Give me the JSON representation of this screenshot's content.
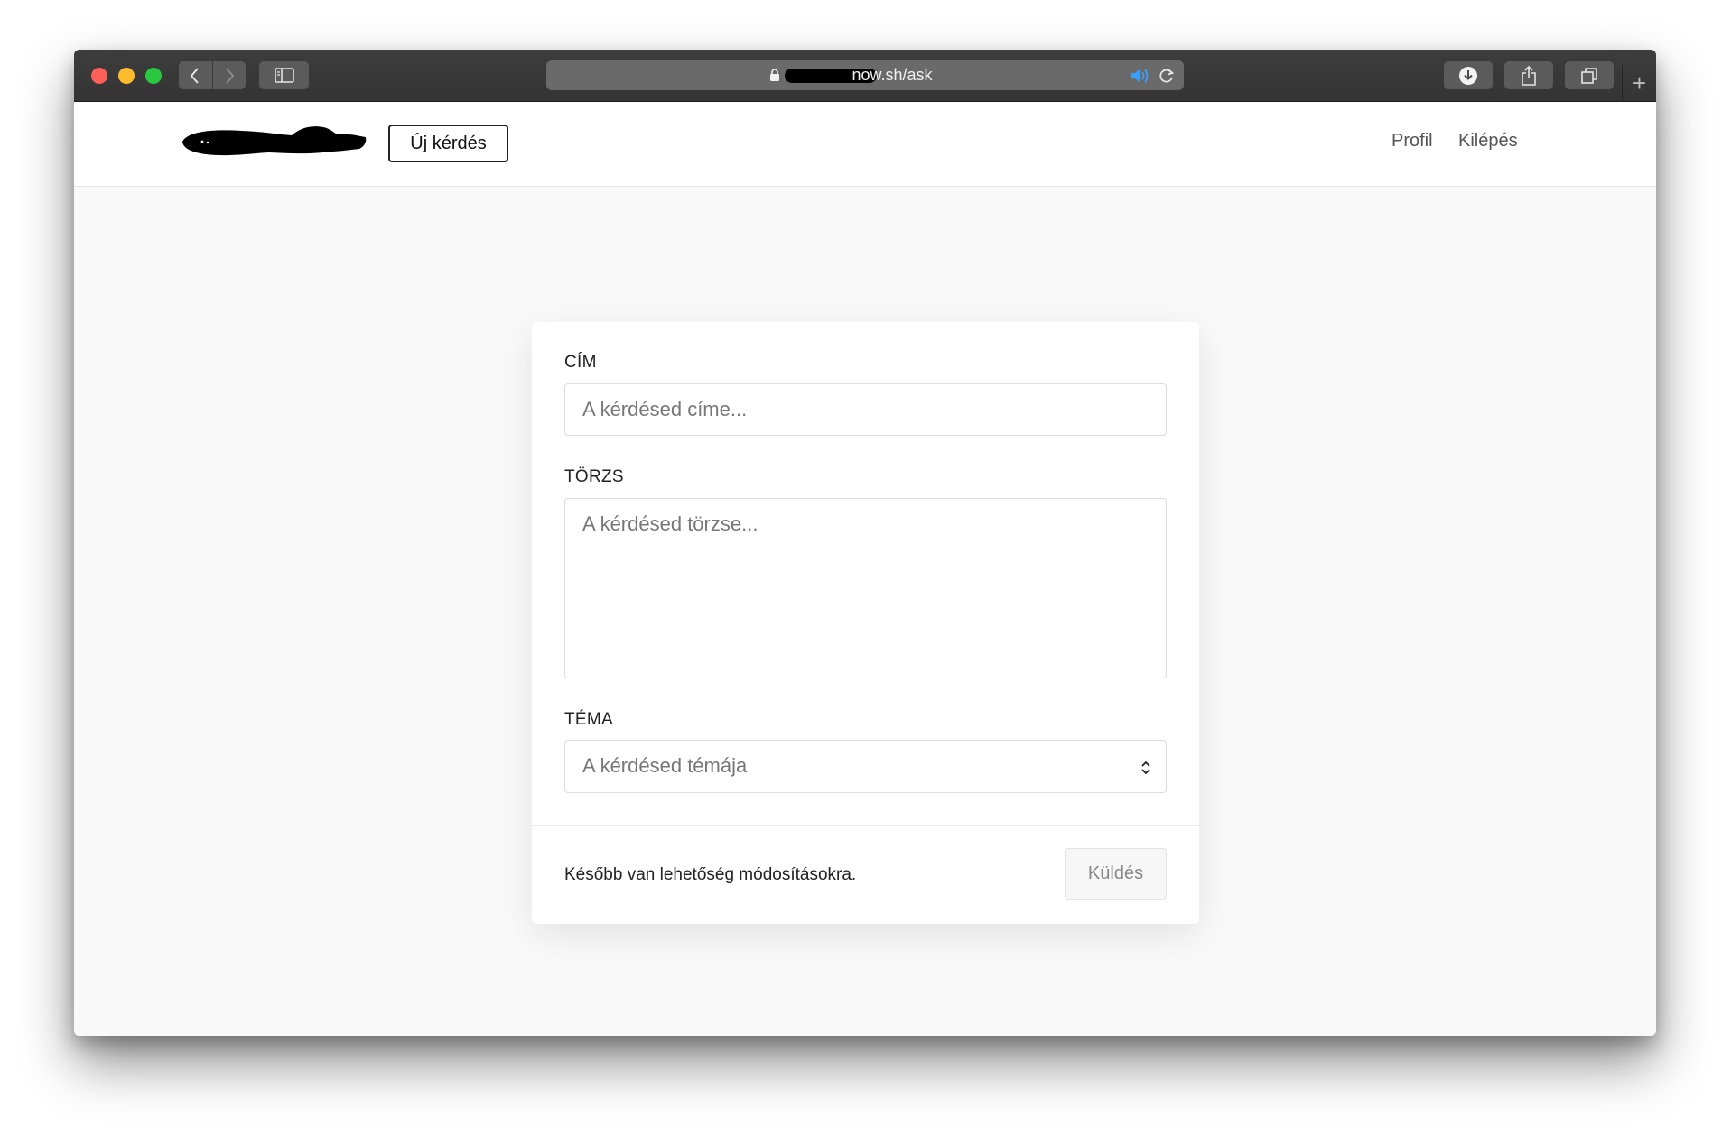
{
  "browser": {
    "url": "now.sh/ask",
    "new_tab_label": "+"
  },
  "navbar": {
    "new_question_label": "Új kérdés",
    "profile_label": "Profil",
    "logout_label": "Kilépés"
  },
  "form": {
    "title_label": "CÍM",
    "title_placeholder": "A kérdésed címe...",
    "body_label": "TÖRZS",
    "body_placeholder": "A kérdésed törzse...",
    "topic_label": "TÉMA",
    "topic_placeholder": "A kérdésed témája",
    "footer_note": "Később van lehetőség módosításokra.",
    "submit_label": "Küldés"
  },
  "colors": {
    "titlebar": "#3a3a3a",
    "speaker_accent": "#3aa0ff",
    "page_bg": "#f9f9f9"
  }
}
